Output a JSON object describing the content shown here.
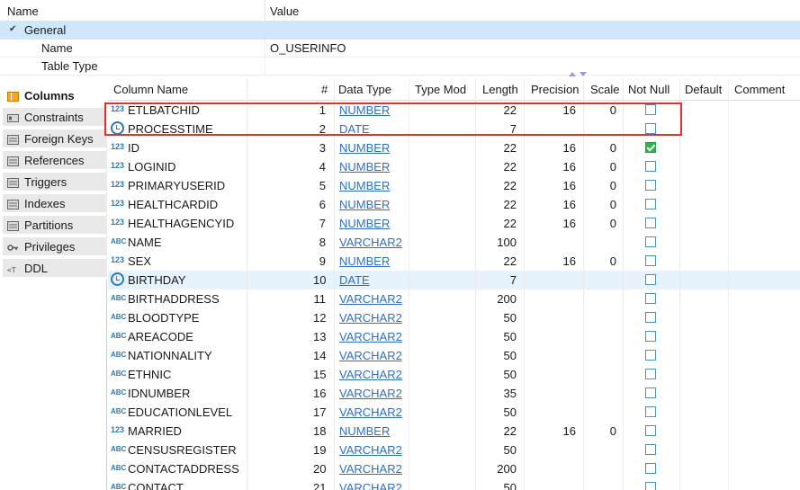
{
  "properties": {
    "header": {
      "name": "Name",
      "value": "Value"
    },
    "group": "General",
    "rows": [
      {
        "name": "Name",
        "value": "O_USERINFO"
      },
      {
        "name": "Table Type",
        "value": ""
      }
    ]
  },
  "tabs": [
    {
      "label": "Columns",
      "icon": "columns-icon",
      "active": true
    },
    {
      "label": "Constraints",
      "icon": "key-icon"
    },
    {
      "label": "Foreign Keys",
      "icon": "foreign-key-icon"
    },
    {
      "label": "References",
      "icon": "references-icon"
    },
    {
      "label": "Triggers",
      "icon": "trigger-icon"
    },
    {
      "label": "Indexes",
      "icon": "index-icon"
    },
    {
      "label": "Partitions",
      "icon": "partition-icon"
    },
    {
      "label": "Privileges",
      "icon": "privilege-key-icon"
    },
    {
      "label": "DDL",
      "icon": "ddl-icon"
    }
  ],
  "grid": {
    "columns": [
      "Column Name",
      "#",
      "Data Type",
      "Type Mod",
      "Length",
      "Precision",
      "Scale",
      "Not Null",
      "Default",
      "Comment"
    ],
    "rows": [
      {
        "icon": "number-type-icon",
        "name": "ETLBATCHID",
        "num": "1",
        "type": "NUMBER",
        "length": "22",
        "precision": "16",
        "scale": "0",
        "notnull": false
      },
      {
        "icon": "date-type-icon",
        "name": "PROCESSTIME",
        "num": "2",
        "type": "DATE",
        "length": "7",
        "precision": "",
        "scale": "",
        "notnull": false
      },
      {
        "icon": "number-type-icon",
        "name": "ID",
        "num": "3",
        "type": "NUMBER",
        "length": "22",
        "precision": "16",
        "scale": "0",
        "notnull": true
      },
      {
        "icon": "number-type-icon",
        "name": "LOGINID",
        "num": "4",
        "type": "NUMBER",
        "length": "22",
        "precision": "16",
        "scale": "0",
        "notnull": false
      },
      {
        "icon": "number-type-icon",
        "name": "PRIMARYUSERID",
        "num": "5",
        "type": "NUMBER",
        "length": "22",
        "precision": "16",
        "scale": "0",
        "notnull": false
      },
      {
        "icon": "number-type-icon",
        "name": "HEALTHCARDID",
        "num": "6",
        "type": "NUMBER",
        "length": "22",
        "precision": "16",
        "scale": "0",
        "notnull": false
      },
      {
        "icon": "number-type-icon",
        "name": "HEALTHAGENCYID",
        "num": "7",
        "type": "NUMBER",
        "length": "22",
        "precision": "16",
        "scale": "0",
        "notnull": false
      },
      {
        "icon": "string-type-icon",
        "name": "NAME",
        "num": "8",
        "type": "VARCHAR2",
        "length": "100",
        "precision": "",
        "scale": "",
        "notnull": false
      },
      {
        "icon": "number-type-icon",
        "name": "SEX",
        "num": "9",
        "type": "NUMBER",
        "length": "22",
        "precision": "16",
        "scale": "0",
        "notnull": false
      },
      {
        "icon": "date-type-icon",
        "name": "BIRTHDAY",
        "num": "10",
        "type": "DATE",
        "length": "7",
        "precision": "",
        "scale": "",
        "notnull": false,
        "selected": true
      },
      {
        "icon": "string-type-icon",
        "name": "BIRTHADDRESS",
        "num": "11",
        "type": "VARCHAR2",
        "length": "200",
        "precision": "",
        "scale": "",
        "notnull": false
      },
      {
        "icon": "string-type-icon",
        "name": "BLOODTYPE",
        "num": "12",
        "type": "VARCHAR2",
        "length": "50",
        "precision": "",
        "scale": "",
        "notnull": false
      },
      {
        "icon": "string-type-icon",
        "name": "AREACODE",
        "num": "13",
        "type": "VARCHAR2",
        "length": "50",
        "precision": "",
        "scale": "",
        "notnull": false
      },
      {
        "icon": "string-type-icon",
        "name": "NATIONNALITY",
        "num": "14",
        "type": "VARCHAR2",
        "length": "50",
        "precision": "",
        "scale": "",
        "notnull": false
      },
      {
        "icon": "string-type-icon",
        "name": "ETHNIC",
        "num": "15",
        "type": "VARCHAR2",
        "length": "50",
        "precision": "",
        "scale": "",
        "notnull": false
      },
      {
        "icon": "string-type-icon",
        "name": "IDNUMBER",
        "num": "16",
        "type": "VARCHAR2",
        "length": "35",
        "precision": "",
        "scale": "",
        "notnull": false
      },
      {
        "icon": "string-type-icon",
        "name": "EDUCATIONLEVEL",
        "num": "17",
        "type": "VARCHAR2",
        "length": "50",
        "precision": "",
        "scale": "",
        "notnull": false
      },
      {
        "icon": "number-type-icon",
        "name": "MARRIED",
        "num": "18",
        "type": "NUMBER",
        "length": "22",
        "precision": "16",
        "scale": "0",
        "notnull": false
      },
      {
        "icon": "string-type-icon",
        "name": "CENSUSREGISTER",
        "num": "19",
        "type": "VARCHAR2",
        "length": "50",
        "precision": "",
        "scale": "",
        "notnull": false
      },
      {
        "icon": "string-type-icon",
        "name": "CONTACTADDRESS",
        "num": "20",
        "type": "VARCHAR2",
        "length": "200",
        "precision": "",
        "scale": "",
        "notnull": false
      },
      {
        "icon": "string-type-icon",
        "name": "CONTACT",
        "num": "21",
        "type": "VARCHAR2",
        "length": "50",
        "precision": "",
        "scale": "",
        "notnull": false
      }
    ]
  },
  "type_icon_text": {
    "number": "123",
    "string": "ABC"
  },
  "colors": {
    "highlight_box": "#e53030",
    "selected_row": "#e6f2fc",
    "group_header": "#cfe6fb",
    "link": "#2e6fc4"
  }
}
